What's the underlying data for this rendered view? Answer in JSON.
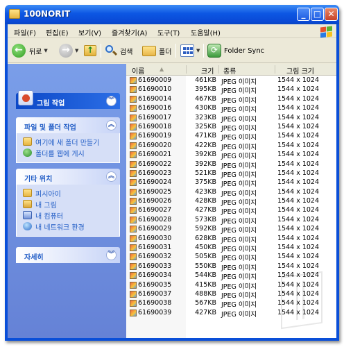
{
  "window": {
    "title": "100NORIT",
    "min_label": "_",
    "max_label": "□",
    "close_label": "✕"
  },
  "menu": [
    "파일(F)",
    "편집(E)",
    "보기(V)",
    "즐겨찾기(A)",
    "도구(T)",
    "도움말(H)"
  ],
  "toolbar": {
    "back_label": "뒤로",
    "back_icon": "back-arrow-icon",
    "forward_icon": "forward-arrow-icon",
    "up_icon": "folder-up-icon",
    "search_label": "검색",
    "folders_label": "폴더",
    "views_icon": "views-icon",
    "sync_label": "Folder Sync"
  },
  "left": {
    "picture_tasks": {
      "title": "그림 작업",
      "chevron": "︾"
    },
    "file_tasks": {
      "title": "파일 및 폴더 작업",
      "chevron": "︽",
      "items": [
        {
          "label": "여기에 새 폴더 만들기",
          "icon": "new-folder-icon"
        },
        {
          "label": "폴더를 웹에 게시",
          "icon": "publish-web-icon"
        }
      ]
    },
    "other_places": {
      "title": "기타 위치",
      "chevron": "︽",
      "items": [
        {
          "label": "피시아이",
          "icon": "folder-icon"
        },
        {
          "label": "내 그림",
          "icon": "my-pictures-icon"
        },
        {
          "label": "내 컴퓨터",
          "icon": "my-computer-icon"
        },
        {
          "label": "내 네트워크 환경",
          "icon": "network-icon"
        }
      ]
    },
    "details": {
      "title": "자세히",
      "chevron": "︾"
    }
  },
  "columns": {
    "name": "이름",
    "sort_arrow": "▲",
    "size": "크기",
    "type": "종류",
    "dims": "그림 크기"
  },
  "files": [
    {
      "name": "61690009",
      "size": "461KB",
      "type": "JPEG 이미지",
      "dims": "1544 x 1024"
    },
    {
      "name": "61690010",
      "size": "395KB",
      "type": "JPEG 이미지",
      "dims": "1544 x 1024"
    },
    {
      "name": "61690014",
      "size": "467KB",
      "type": "JPEG 이미지",
      "dims": "1544 x 1024"
    },
    {
      "name": "61690016",
      "size": "430KB",
      "type": "JPEG 이미지",
      "dims": "1544 x 1024"
    },
    {
      "name": "61690017",
      "size": "323KB",
      "type": "JPEG 이미지",
      "dims": "1544 x 1024"
    },
    {
      "name": "61690018",
      "size": "325KB",
      "type": "JPEG 이미지",
      "dims": "1544 x 1024"
    },
    {
      "name": "61690019",
      "size": "471KB",
      "type": "JPEG 이미지",
      "dims": "1544 x 1024"
    },
    {
      "name": "61690020",
      "size": "422KB",
      "type": "JPEG 이미지",
      "dims": "1544 x 1024"
    },
    {
      "name": "61690021",
      "size": "392KB",
      "type": "JPEG 이미지",
      "dims": "1544 x 1024"
    },
    {
      "name": "61690022",
      "size": "392KB",
      "type": "JPEG 이미지",
      "dims": "1544 x 1024"
    },
    {
      "name": "61690023",
      "size": "521KB",
      "type": "JPEG 이미지",
      "dims": "1544 x 1024"
    },
    {
      "name": "61690024",
      "size": "375KB",
      "type": "JPEG 이미지",
      "dims": "1544 x 1024"
    },
    {
      "name": "61690025",
      "size": "423KB",
      "type": "JPEG 이미지",
      "dims": "1544 x 1024"
    },
    {
      "name": "61690026",
      "size": "428KB",
      "type": "JPEG 이미지",
      "dims": "1544 x 1024"
    },
    {
      "name": "61690027",
      "size": "427KB",
      "type": "JPEG 이미지",
      "dims": "1544 x 1024"
    },
    {
      "name": "61690028",
      "size": "573KB",
      "type": "JPEG 이미지",
      "dims": "1544 x 1024"
    },
    {
      "name": "61690029",
      "size": "592KB",
      "type": "JPEG 이미지",
      "dims": "1544 x 1024"
    },
    {
      "name": "61690030",
      "size": "628KB",
      "type": "JPEG 이미지",
      "dims": "1544 x 1024"
    },
    {
      "name": "61690031",
      "size": "450KB",
      "type": "JPEG 이미지",
      "dims": "1544 x 1024"
    },
    {
      "name": "61690032",
      "size": "505KB",
      "type": "JPEG 이미지",
      "dims": "1544 x 1024"
    },
    {
      "name": "61690033",
      "size": "550KB",
      "type": "JPEG 이미지",
      "dims": "1544 x 1024"
    },
    {
      "name": "61690034",
      "size": "544KB",
      "type": "JPEG 이미지",
      "dims": "1544 x 1024"
    },
    {
      "name": "61690035",
      "size": "415KB",
      "type": "JPEG 이미지",
      "dims": "1544 x 1024"
    },
    {
      "name": "61690037",
      "size": "488KB",
      "type": "JPEG 이미지",
      "dims": "1544 x 1024"
    },
    {
      "name": "61690038",
      "size": "567KB",
      "type": "JPEG 이미지",
      "dims": "1544 x 1024"
    },
    {
      "name": "61690039",
      "size": "427KB",
      "type": "JPEG 이미지",
      "dims": "1544 x 1024"
    }
  ]
}
